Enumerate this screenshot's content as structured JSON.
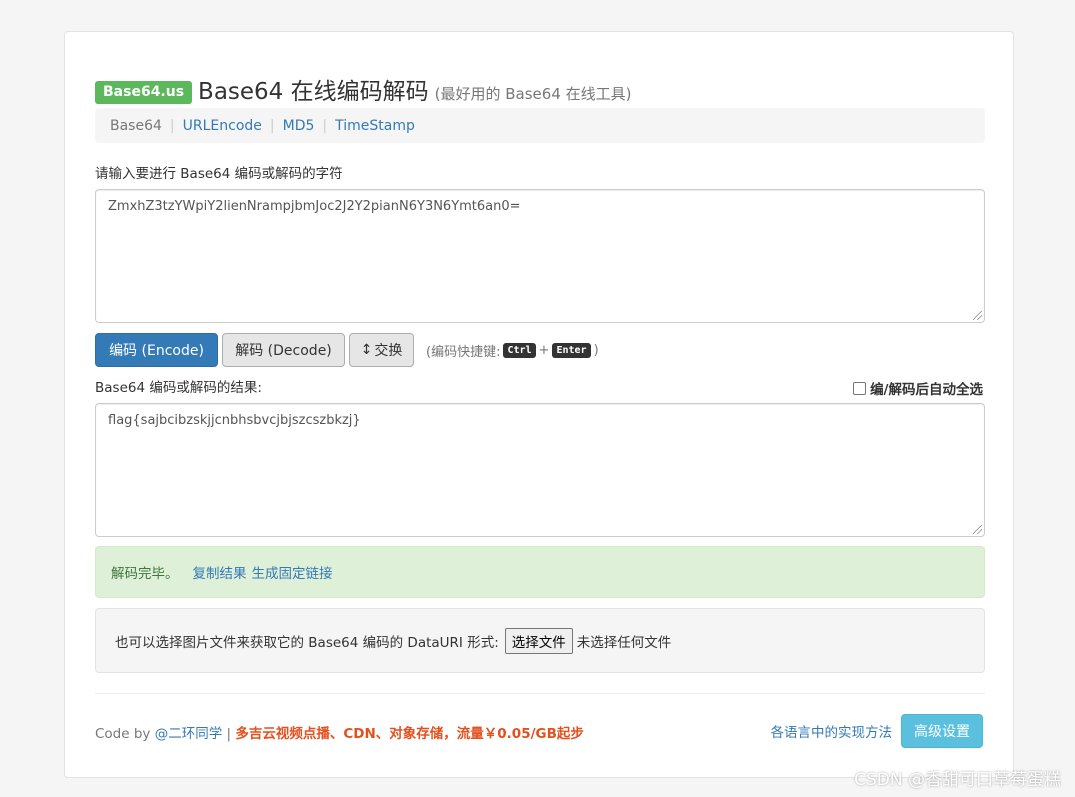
{
  "header": {
    "logo_badge": "Base64.us",
    "title": "Base64 在线编码解码",
    "subtitle": "(最好用的 Base64 在线工具)"
  },
  "nav": {
    "items": [
      {
        "label": "Base64",
        "current": true
      },
      {
        "label": "URLEncode",
        "current": false
      },
      {
        "label": "MD5",
        "current": false
      },
      {
        "label": "TimeStamp",
        "current": false
      }
    ],
    "separator": "|"
  },
  "input": {
    "label": "请输入要进行 Base64 编码或解码的字符",
    "value": "ZmxhZ3tzYWpiY2lienNrampjbmJoc2J2Y2pianN6Y3N6Ymt6an0="
  },
  "buttons": {
    "encode": "编码 (Encode)",
    "decode": "解码 (Decode)",
    "swap_icon": "↕",
    "swap": "交换",
    "hint_prefix": "(编码快捷键:",
    "key_ctrl": "Ctrl",
    "plus": "+",
    "key_enter": "Enter",
    "hint_suffix": ")"
  },
  "output": {
    "label": "Base64 编码或解码的结果:",
    "auto_select_label": "编/解码后自动全选",
    "auto_select_checked": false,
    "value": "flag{sajbcibzskjjcnbhsbvcjbjszcszbkzj}"
  },
  "alert": {
    "status": "解码完毕。",
    "copy_link": "复制结果",
    "permalink": "生成固定链接",
    "color": "#dff0d8"
  },
  "file": {
    "prompt": "也可以选择图片文件来获取它的 Base64 编码的 DataURI 形式:",
    "button": "选择文件",
    "status": "未选择任何文件"
  },
  "footer": {
    "code_by": "Code by",
    "author": "@二环同学",
    "sep": "|",
    "promo": "多吉云视频点播、CDN、对象存储，流量￥0.05/GB起步",
    "impl_link": "各语言中的实现方法",
    "advanced_button": "高级设置"
  },
  "watermark": "CSDN @香甜可口草莓蛋糕",
  "colors": {
    "primary": "#337ab7",
    "success": "#5cb85c",
    "info": "#5bc0de",
    "promo": "#e4501e"
  }
}
